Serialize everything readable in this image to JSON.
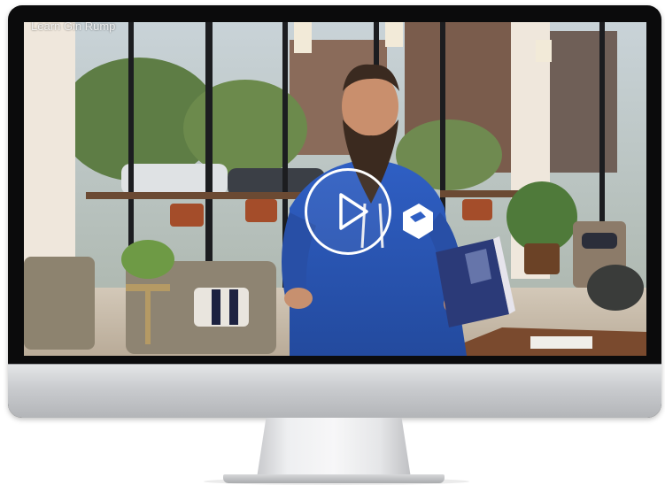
{
  "video": {
    "title": "Learn Gin Rump",
    "play_icon": "play-icon",
    "hoodie_logo_icon": "brand-logo-icon"
  },
  "colors": {
    "bezel": "#0b0b0c",
    "chin": "#c9cbce",
    "hoodie": "#2a56b6",
    "play_ring": "#ffffff"
  }
}
